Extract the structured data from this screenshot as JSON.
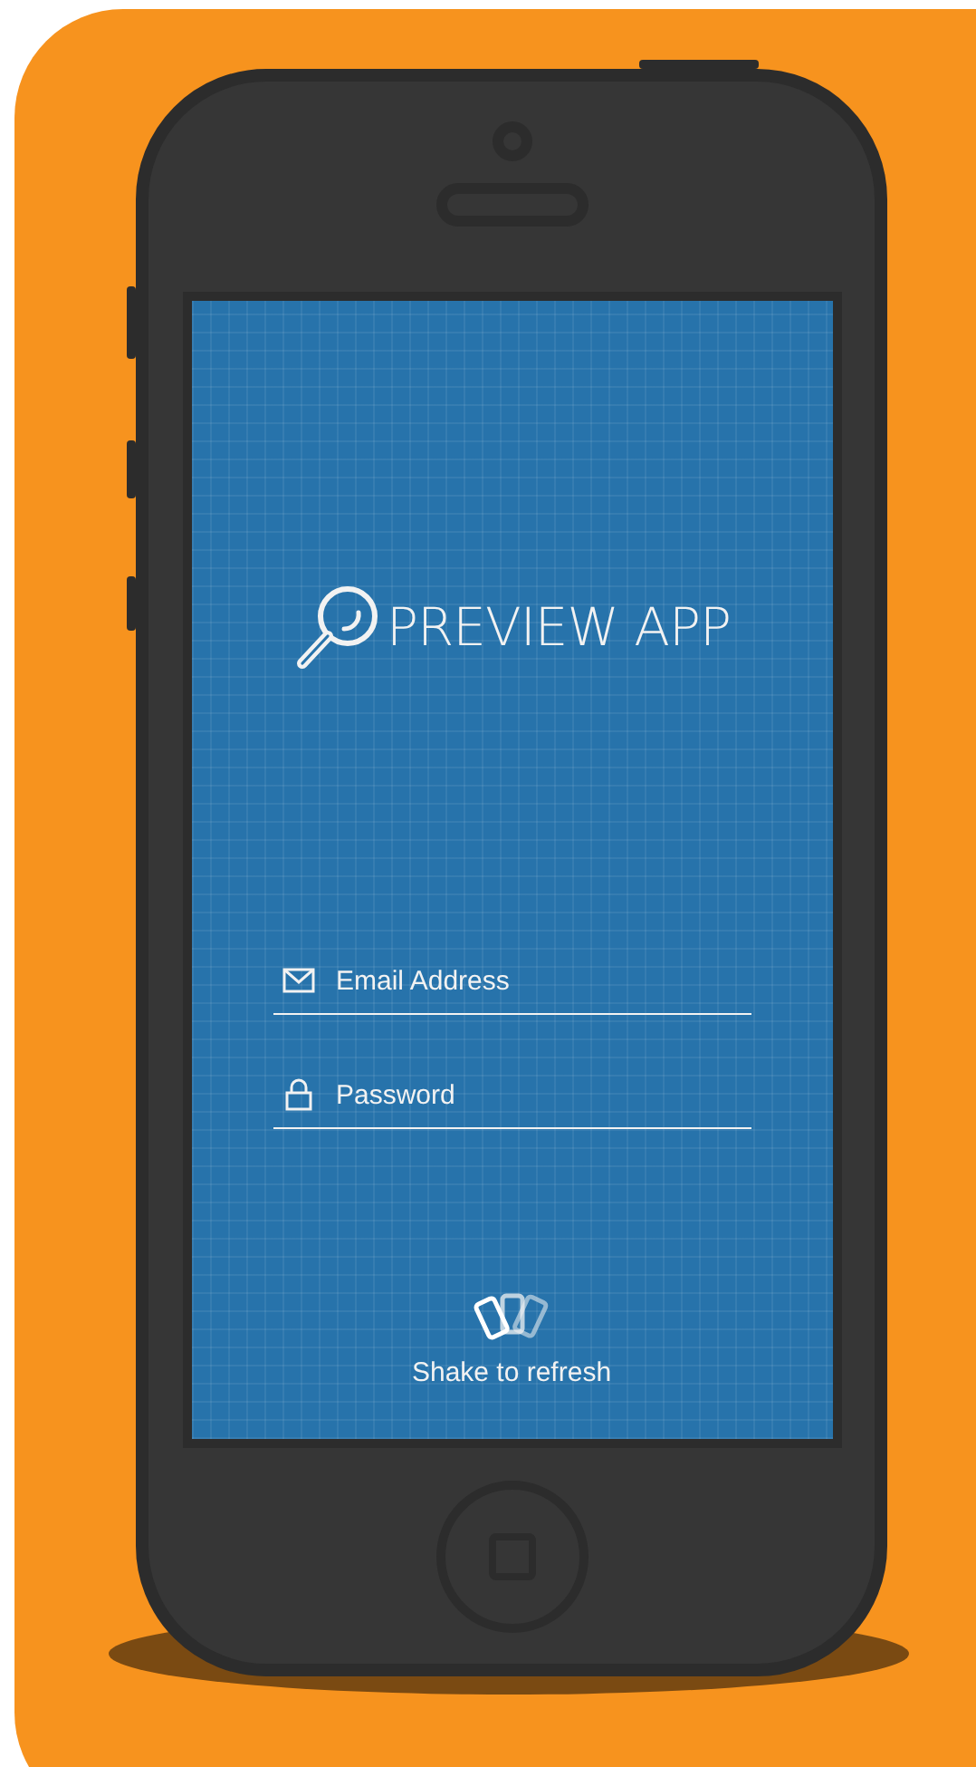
{
  "app": {
    "logo_text": "PREVIEW APP"
  },
  "fields": [
    {
      "kind": "email",
      "placeholder": "Email Address"
    },
    {
      "kind": "password",
      "placeholder": "Password"
    }
  ],
  "shake_hint": "Shake to refresh"
}
